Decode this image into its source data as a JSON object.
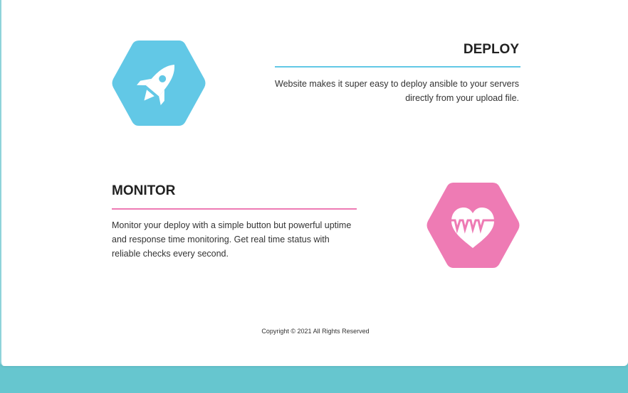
{
  "theme": {
    "deploy_color": "#62c8e6",
    "monitor_color": "#ee7bb4",
    "background_gradient": "#6fc7cc"
  },
  "features": [
    {
      "id": "deploy",
      "icon": "rocket-icon",
      "title": "DEPLOY",
      "text": "Website makes it super easy to deploy ansible to your servers directly from your upload file."
    },
    {
      "id": "monitor",
      "icon": "heart-pulse-icon",
      "title": "MONITOR",
      "text": "Monitor your deploy with a simple button but powerful uptime and response time monitoring. Get real time status with reliable checks every second."
    }
  ],
  "footer": {
    "copyright": "Copyright © 2021 All Rights Reserved"
  }
}
